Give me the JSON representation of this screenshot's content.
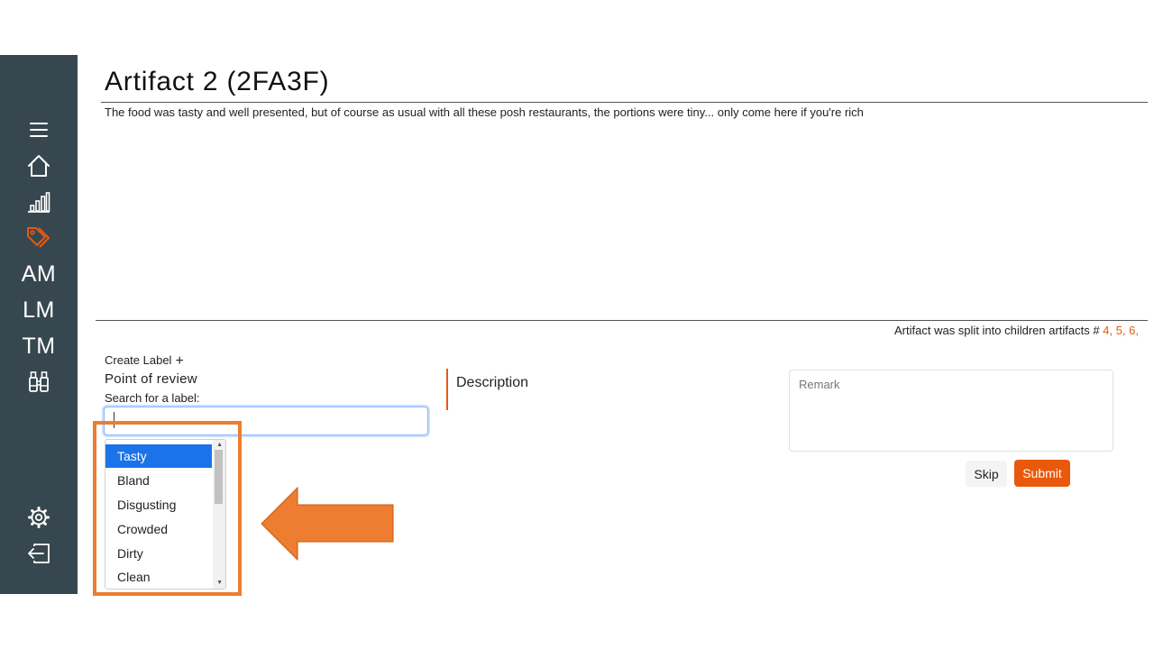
{
  "theme": {
    "accent": "#e8590c",
    "sidebar_bg": "#37474f",
    "selected_bg": "#1a73e8",
    "annotation": "#ed7d31"
  },
  "sidebar": {
    "items": [
      {
        "icon": "menu-icon",
        "active": false
      },
      {
        "icon": "home-icon",
        "active": false
      },
      {
        "icon": "bar-chart-icon",
        "active": false
      },
      {
        "icon": "tags-icon",
        "active": true
      },
      {
        "label": "AM"
      },
      {
        "label": "LM"
      },
      {
        "label": "TM"
      },
      {
        "icon": "binoculars-icon",
        "active": false
      },
      {
        "icon": "gear-icon",
        "active": false
      },
      {
        "icon": "logout-icon",
        "active": false
      }
    ]
  },
  "artifact": {
    "title": "Artifact 2 (2FA3F)",
    "text": "The food was tasty and well presented, but of course as usual with all these posh restaurants, the portions were tiny... only come here if you're rich",
    "split_prefix": "Artifact was split into children artifacts # ",
    "children": [
      "4,",
      "5,",
      "6,"
    ]
  },
  "labeling": {
    "create_label": "Create Label",
    "create_icon": "plus-icon",
    "category": "Point of review",
    "search_label": "Search for a label:",
    "search_value": "",
    "options": [
      "Tasty",
      "Bland",
      "Disgusting",
      "Crowded",
      "Dirty",
      "Clean"
    ],
    "selected_option": "Tasty"
  },
  "description": {
    "label": "Description"
  },
  "remark": {
    "placeholder": "Remark"
  },
  "actions": {
    "skip": "Skip",
    "submit": "Submit"
  }
}
